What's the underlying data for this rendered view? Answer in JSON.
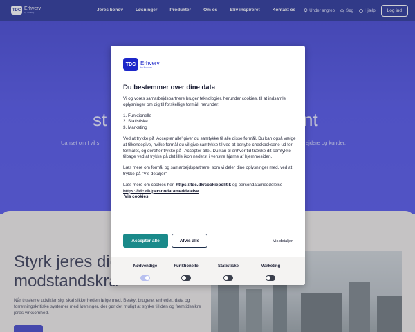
{
  "brand": {
    "logo_mark": "TDC",
    "name": "Erhverv",
    "tagline": "by Nuuday"
  },
  "nav": {
    "links": [
      "Jeres behov",
      "Løsninger",
      "Produkter",
      "Om os",
      "Bliv inspireret",
      "Kontakt os"
    ],
    "utility": {
      "store": "Under angreb",
      "search": "Søg",
      "help": "Hjælp"
    },
    "login_label": "Log ind"
  },
  "hero": {
    "title_left": "st",
    "title_right": "nt",
    "sub_left": "Uanset om I vil s",
    "sub_right": "ejdere og kunder,"
  },
  "section": {
    "title_line1": "Styrk jeres dig",
    "title_line2": "modstandskra",
    "text": "Når truslerne udvikler sig, skal sikkerheden følge med. Beskyt brugere, enheder, data og forretningskritiske systemer med løsninger, der gør det muligt at styrke tilliden og fremtidssikre jeres virksomhed."
  },
  "cookie_modal": {
    "logo_mark": "TDC",
    "logo_name": "Erhverv",
    "logo_tagline": "by Nuuday",
    "title": "Du bestemmer over dine data",
    "intro": "Vi og vores samarbejdspartnere bruger teknologier, herunder cookies, til at indsamle oplysninger om dig til forskellige formål, herunder:",
    "purposes": [
      "1. Funktionelle",
      "2. Statistiske",
      "3. Marketing"
    ],
    "consent_text": "Ved at trykke på 'Accepter alle' giver du samtykke til alle disse formål. Du kan også vælge at tilkendegive, hvilke formål du vil give samtykke til ved at benytte checkboksene ud for formålet, og derefter trykke på ' Accepter alle'. Du kan til enhver tid trække dit samtykke tilbage ved at trykke på det lille ikon nederst i venstre hjørne af hjemmesiden.",
    "more_info": "Læs mere om formål og samarbejdspartnere, som vi deler dine oplysninger med, ved at trykke på \"Vis detaljer\"",
    "cookies_prefix": "Læs mere om cookies her: ",
    "cookies_link": "https://tdc.dk/cookiepolitik",
    "cookies_and": " og ",
    "privacy_prefix": "persondatameddelelse ",
    "privacy_link": "https://tdc.dk/persondatameddelelse",
    "show_cookies": "Vis cookies",
    "accept_all": "Accepter alle",
    "reject_all": "Afvis alle",
    "show_details": "Vis detaljer",
    "toggles": [
      {
        "label": "Nødvendige",
        "state": "on"
      },
      {
        "label": "Funktionelle",
        "state": "off"
      },
      {
        "label": "Statistiske",
        "state": "off"
      },
      {
        "label": "Marketing",
        "state": "off"
      }
    ]
  },
  "colors": {
    "nav_bg": "#0c1a8c",
    "hero_bg": "#3a3de6",
    "accept": "#1a8a8a",
    "brand_blue": "#1d27c9"
  }
}
